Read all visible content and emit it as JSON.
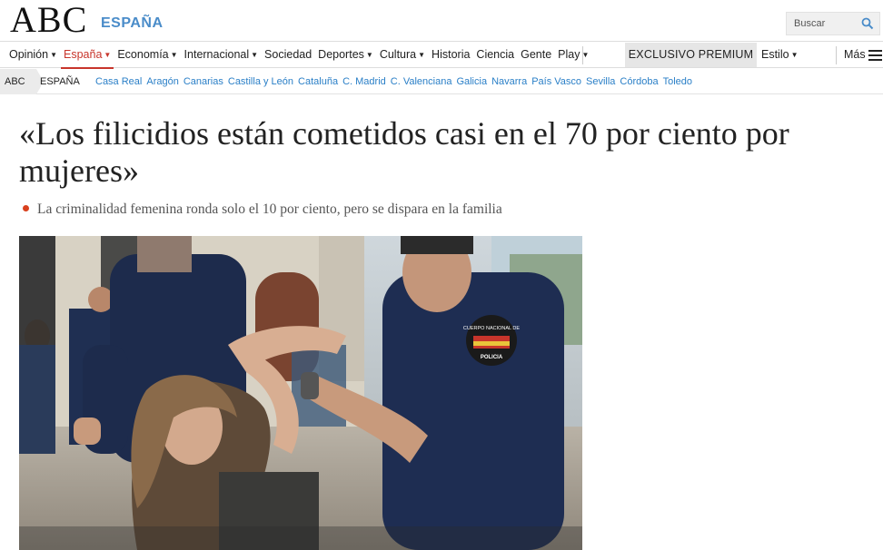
{
  "header": {
    "logo": "ABC",
    "section": "ESPAÑA",
    "search_placeholder": "Buscar"
  },
  "nav": {
    "items": [
      {
        "label": "Opinión",
        "caret": true
      },
      {
        "label": "España",
        "caret": true,
        "active": true
      },
      {
        "label": "Economía",
        "caret": true
      },
      {
        "label": "Internacional",
        "caret": true
      },
      {
        "label": "Sociedad",
        "caret": false
      },
      {
        "label": "Deportes",
        "caret": true
      },
      {
        "label": "Cultura",
        "caret": true
      },
      {
        "label": "Historia",
        "caret": false
      },
      {
        "label": "Ciencia",
        "caret": false
      },
      {
        "label": "Gente",
        "caret": false
      },
      {
        "label": "Play",
        "caret": true
      }
    ],
    "premium": "EXCLUSIVO PREMIUM",
    "estilo": "Estilo",
    "mas": "Más"
  },
  "breadcrumb": {
    "root": "ABC",
    "current": "ESPAÑA",
    "regions": [
      "Casa Real",
      "Aragón",
      "Canarias",
      "Castilla y León",
      "Cataluña",
      "C. Madrid",
      "C. Valenciana",
      "Galicia",
      "Navarra",
      "País Vasco",
      "Sevilla",
      "Córdoba",
      "Toledo"
    ]
  },
  "article": {
    "headline": "«Los filicidios están cometidos casi en el 70 por ciento por mujeres»",
    "subtitle": "La criminalidad femenina ronda solo el 10 por ciento, pero se dispara en la familia",
    "photo_badge": "CUERPO NACIONAL DE POLICIA"
  },
  "colors": {
    "accent_red": "#c8352b",
    "link_blue": "#2a7fc7",
    "section_blue": "#4a8cc9",
    "bullet": "#d9411e"
  }
}
